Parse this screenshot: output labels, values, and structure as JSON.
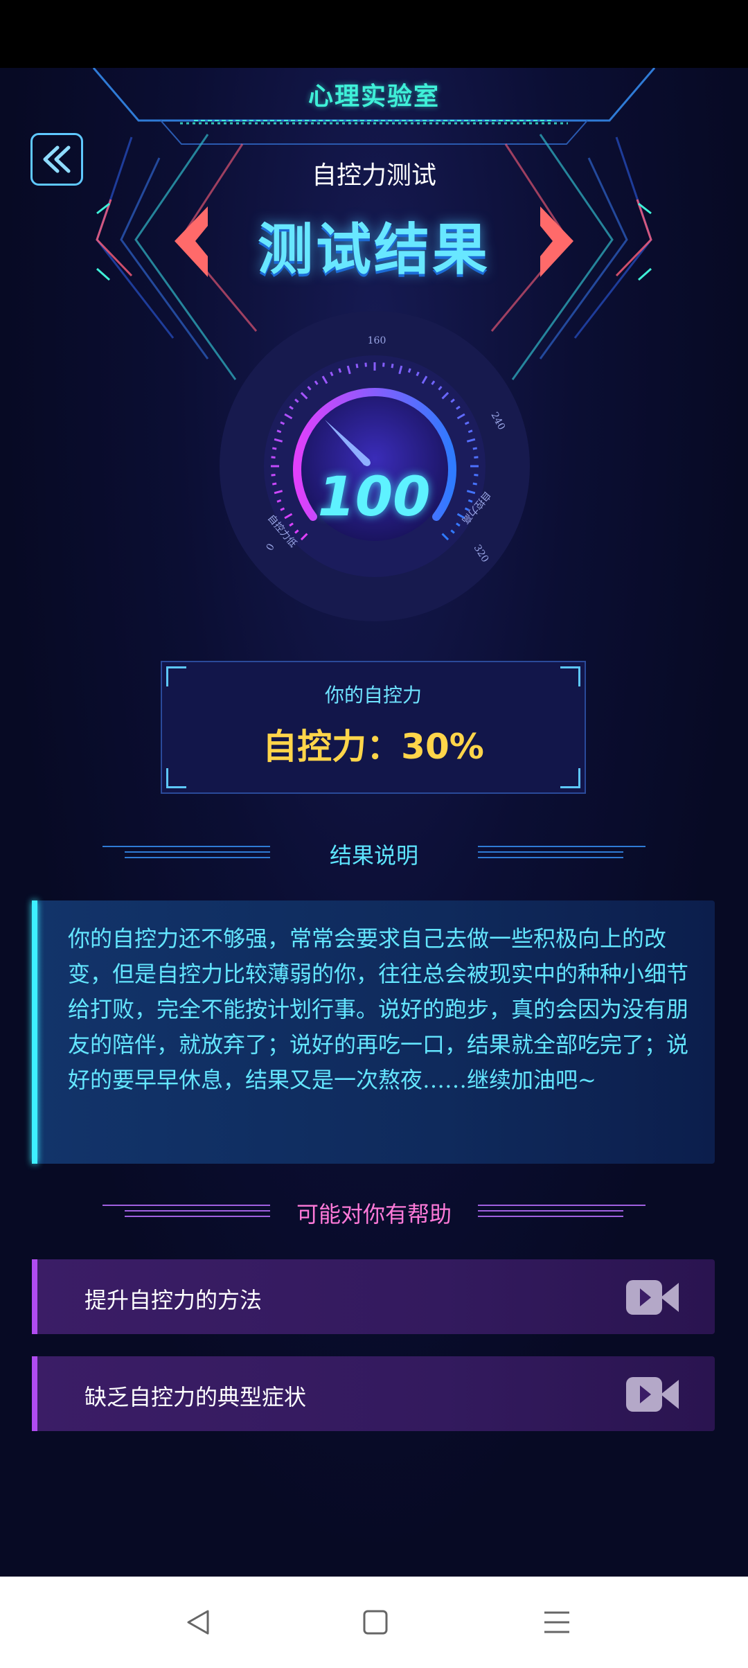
{
  "header": {
    "app_title": "心理实验室",
    "back_icon": "double-chevron-left-icon",
    "subtitle": "自控力测试",
    "result_title": "测试结果"
  },
  "gauge": {
    "value": "100",
    "ticks": [
      "0",
      "160",
      "240",
      "320"
    ],
    "low_label": "自控力低",
    "high_label": "自控力高",
    "colors": {
      "start": "#e040fb",
      "end": "#2f7bff"
    }
  },
  "score": {
    "label": "你的自控力",
    "text": "自控力：30%"
  },
  "sections": {
    "result_heading": "结果说明",
    "help_heading": "可能对你有帮助"
  },
  "description": "你的自控力还不够强，常常会要求自己去做一些积极向上的改变，但是自控力比较薄弱的你，往往总会被现实中的种种小细节给打败，完全不能按计划行事。说好的跑步，真的会因为没有朋友的陪伴，就放弃了；说好的再吃一口，结果就全部吃完了；说好的要早早休息，结果又是一次熬夜……继续加油吧~",
  "help_items": [
    {
      "label": "提升自控力的方法",
      "icon": "video-camera-icon"
    },
    {
      "label": "缺乏自控力的典型症状",
      "icon": "video-camera-icon"
    }
  ],
  "colors": {
    "background": "#070a24",
    "cyan_accent": "#3ef0ff",
    "purple_accent": "#b04cf0",
    "score_yellow": "#ffd54a"
  }
}
